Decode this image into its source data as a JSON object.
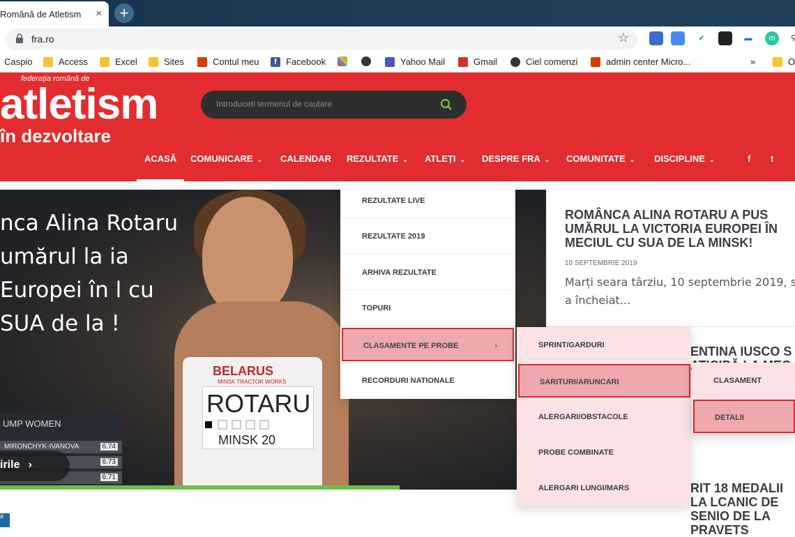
{
  "browser": {
    "tab_title": "Română de Atletism",
    "tab_close": "×",
    "new_tab": "+",
    "url": "fra.ro",
    "star": "☆"
  },
  "bookmarks": [
    {
      "label": "Caspio",
      "icon": "caspio-icon"
    },
    {
      "label": "Access",
      "icon": "folder-icon"
    },
    {
      "label": "Excel",
      "icon": "folder-icon"
    },
    {
      "label": "Sites",
      "icon": "folder-icon"
    },
    {
      "label": "Contul meu",
      "icon": "office-icon"
    },
    {
      "label": "Facebook",
      "icon": "facebook-icon"
    },
    {
      "label": "",
      "icon": "joomla-icon"
    },
    {
      "label": "",
      "icon": "globe-icon"
    },
    {
      "label": "Yahoo Mail",
      "icon": "yahoo-mail-icon"
    },
    {
      "label": "Gmail",
      "icon": "gmail-icon"
    },
    {
      "label": "Ciel comenzi",
      "icon": "globe-icon"
    },
    {
      "label": "admin center Micro...",
      "icon": "office-icon"
    },
    {
      "label": "»",
      "icon": "overflow-icon"
    },
    {
      "label": "O",
      "icon": "folder-icon"
    }
  ],
  "site": {
    "logo_small": "federația română de",
    "logo_big": "atletism",
    "logo_sub": "în dezvoltare",
    "search_placeholder": "Introduceti termenul de cautare",
    "nav": [
      {
        "label": "ACASĂ",
        "chev": ""
      },
      {
        "label": "COMUNICARE",
        "chev": "⌄"
      },
      {
        "label": "CALENDAR",
        "chev": ""
      },
      {
        "label": "REZULTATE",
        "chev": "⌄"
      },
      {
        "label": "ATLEȚI",
        "chev": "⌄"
      },
      {
        "label": "DESPRE FRA",
        "chev": "⌄"
      },
      {
        "label": "COMUNITATE",
        "chev": "⌄"
      },
      {
        "label": "DISCIPLINE",
        "chev": "⌄"
      }
    ],
    "social": [
      "f",
      "t"
    ],
    "accent": "#e32c2f"
  },
  "hero": {
    "title": "nca Alina Rotaru umărul la ia Europei în l cu SUA de la !",
    "scoreboard_title": "UMP WOMEN",
    "scoreboard": [
      {
        "name": "MIRONCHYK-IVANOVA",
        "value": "6.74"
      },
      {
        "name": "",
        "value": "6.73"
      },
      {
        "name": "",
        "value": "6.71"
      }
    ],
    "all_news": "irile",
    "arrow": "›",
    "singlet_brand": "BELARUS",
    "singlet_sub": "MINSK TRACTOR WORKS",
    "bib_name": "ROTARU",
    "bib_city": "MINSK 20",
    "slide_count": 5,
    "active_slide": 1
  },
  "article": {
    "title": "ROMÂNCA ALINA ROTARU A PUS UMĂRUL LA VICTORIA EUROPEI ÎN MECIUL CU SUA DE LA MINSK!",
    "date": "10 SEPTEMBRIE 2019",
    "excerpt": "Marți seara târziu, 10 septembrie 2019, s-a încheiat..."
  },
  "article2": {
    "title": "ENTINA IUSCO S",
    "title2": "ATICIPĂ LA MEC"
  },
  "article3": {
    "title": "RIT 18 MEDALII LA LCANIC DE SENIO DE LA PRAVETS"
  },
  "menu_rezultate": [
    {
      "label": "REZULTATE LIVE",
      "sub": ""
    },
    {
      "label": "REZULTATE 2019",
      "sub": ""
    },
    {
      "label": "ARHIVA REZULTATE",
      "sub": ""
    },
    {
      "label": "TOPURI",
      "sub": ""
    },
    {
      "label": "CLASAMENTE PE PROBE",
      "sub": "›"
    },
    {
      "label": "RECORDURI NATIONALE",
      "sub": ""
    }
  ],
  "menu_clasamente": [
    {
      "label": "SPRINT/GARDURI"
    },
    {
      "label": "SARITURI/ARUNCARI"
    },
    {
      "label": "ALERGARI/OBSTACOLE"
    },
    {
      "label": "PROBE COMBINATE"
    },
    {
      "label": "ALERGARI LUNGI/MARS"
    }
  ],
  "menu_sarituri": [
    {
      "label": "CLASAMENT"
    },
    {
      "label": "DETALII"
    }
  ],
  "bottom_tag": "#"
}
